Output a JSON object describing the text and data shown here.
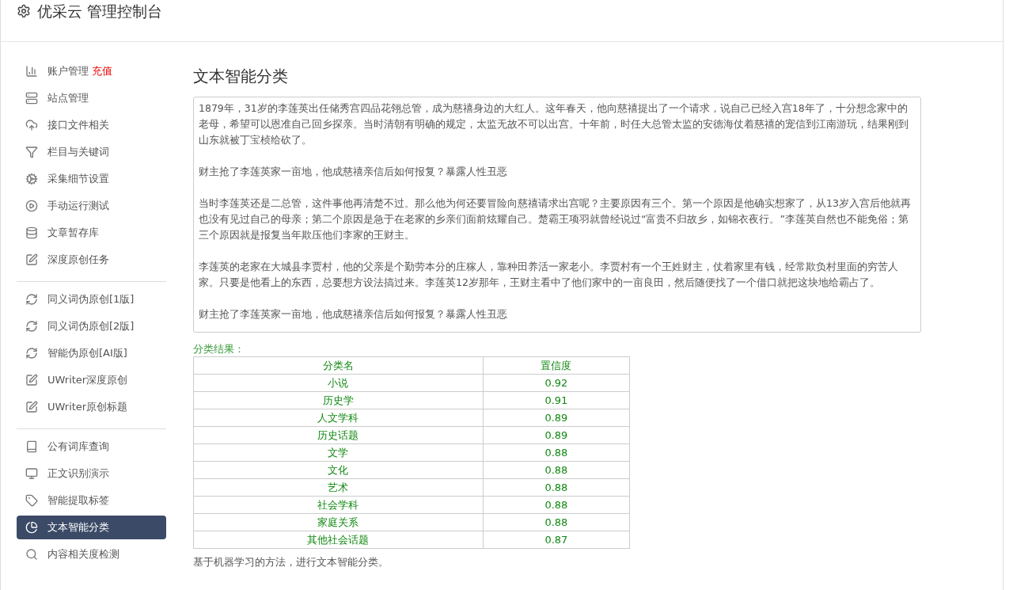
{
  "header": {
    "title": "优采云 管理控制台"
  },
  "sidebar": {
    "groups": [
      {
        "items": [
          {
            "label": "账户管理",
            "badge": "充值",
            "selected": false
          },
          {
            "label": "站点管理",
            "selected": false
          },
          {
            "label": "接口文件相关",
            "selected": false
          },
          {
            "label": "栏目与关键词",
            "selected": false
          },
          {
            "label": "采集细节设置",
            "selected": false
          },
          {
            "label": "手动运行测试",
            "selected": false
          },
          {
            "label": "文章暂存库",
            "selected": false
          },
          {
            "label": "深度原创任务",
            "selected": false
          }
        ]
      },
      {
        "items": [
          {
            "label": "同义词伪原创[1版]",
            "selected": false
          },
          {
            "label": "同义词伪原创[2版]",
            "selected": false
          },
          {
            "label": "智能伪原创[AI版]",
            "selected": false
          },
          {
            "label": "UWriter深度原创",
            "selected": false
          },
          {
            "label": "UWriter原创标题",
            "selected": false
          }
        ]
      },
      {
        "items": [
          {
            "label": "公有词库查询",
            "selected": false
          },
          {
            "label": "正文识别演示",
            "selected": false
          },
          {
            "label": "智能提取标签",
            "selected": false
          },
          {
            "label": "文本智能分类",
            "selected": true
          },
          {
            "label": "内容相关度检测",
            "selected": false
          }
        ]
      }
    ]
  },
  "main": {
    "title": "文本智能分类",
    "input": {
      "paragraphs": [
        "1879年，31岁的李莲英出任储秀宫四品花翎总管，成为慈禧身边的大红人。这年春天，他向慈禧提出了一个请求，说自己已经入宫18年了，十分想念家中的老母，希望可以恩准自己回乡探亲。当时清朝有明确的规定，太监无故不可以出宫。十年前，时任大总管太监的安德海仗着慈禧的宠信到江南游玩，结果刚到山东就被丁宝桢给砍了。",
        "财主抢了李莲英家一亩地，他成慈禧亲信后如何报复？暴露人性丑恶",
        "当时李莲英还是二总管，这件事他再清楚不过。那么他为何还要冒险向慈禧请求出宫呢？主要原因有三个。第一个原因是他确实想家了，从13岁入宫后他就再也没有见过自己的母亲；第二个原因是急于在老家的乡亲们面前炫耀自己。楚霸王项羽就曾经说过“富贵不归故乡，如锦衣夜行。”李莲英自然也不能免俗；第三个原因就是报复当年欺压他们李家的王财主。",
        "李莲英的老家在大城县李贾村，他的父亲是个勤劳本分的庄稼人，靠种田养活一家老小。李贾村有一个王姓财主，仗着家里有钱，经常欺负村里面的穷苦人家。只要是他看上的东西，总要想方设法搞过来。李莲英12岁那年，王财主看中了他们家中的一亩良田，然后随便找了一个借口就把这块地给霸占了。",
        "财主抢了李莲英家一亩地，他成慈禧亲信后如何报复？暴露人性丑恶"
      ]
    },
    "result_label": "分类结果：",
    "table": {
      "columns": [
        "分类名",
        "置信度"
      ],
      "rows": [
        [
          "小说",
          "0.92"
        ],
        [
          "历史学",
          "0.91"
        ],
        [
          "人文学科",
          "0.89"
        ],
        [
          "历史话题",
          "0.89"
        ],
        [
          "文学",
          "0.88"
        ],
        [
          "文化",
          "0.88"
        ],
        [
          "艺术",
          "0.88"
        ],
        [
          "社会学科",
          "0.88"
        ],
        [
          "家庭关系",
          "0.88"
        ],
        [
          "其他社会话题",
          "0.87"
        ]
      ]
    },
    "note": "基于机器学习的方法，进行文本智能分类。"
  }
}
